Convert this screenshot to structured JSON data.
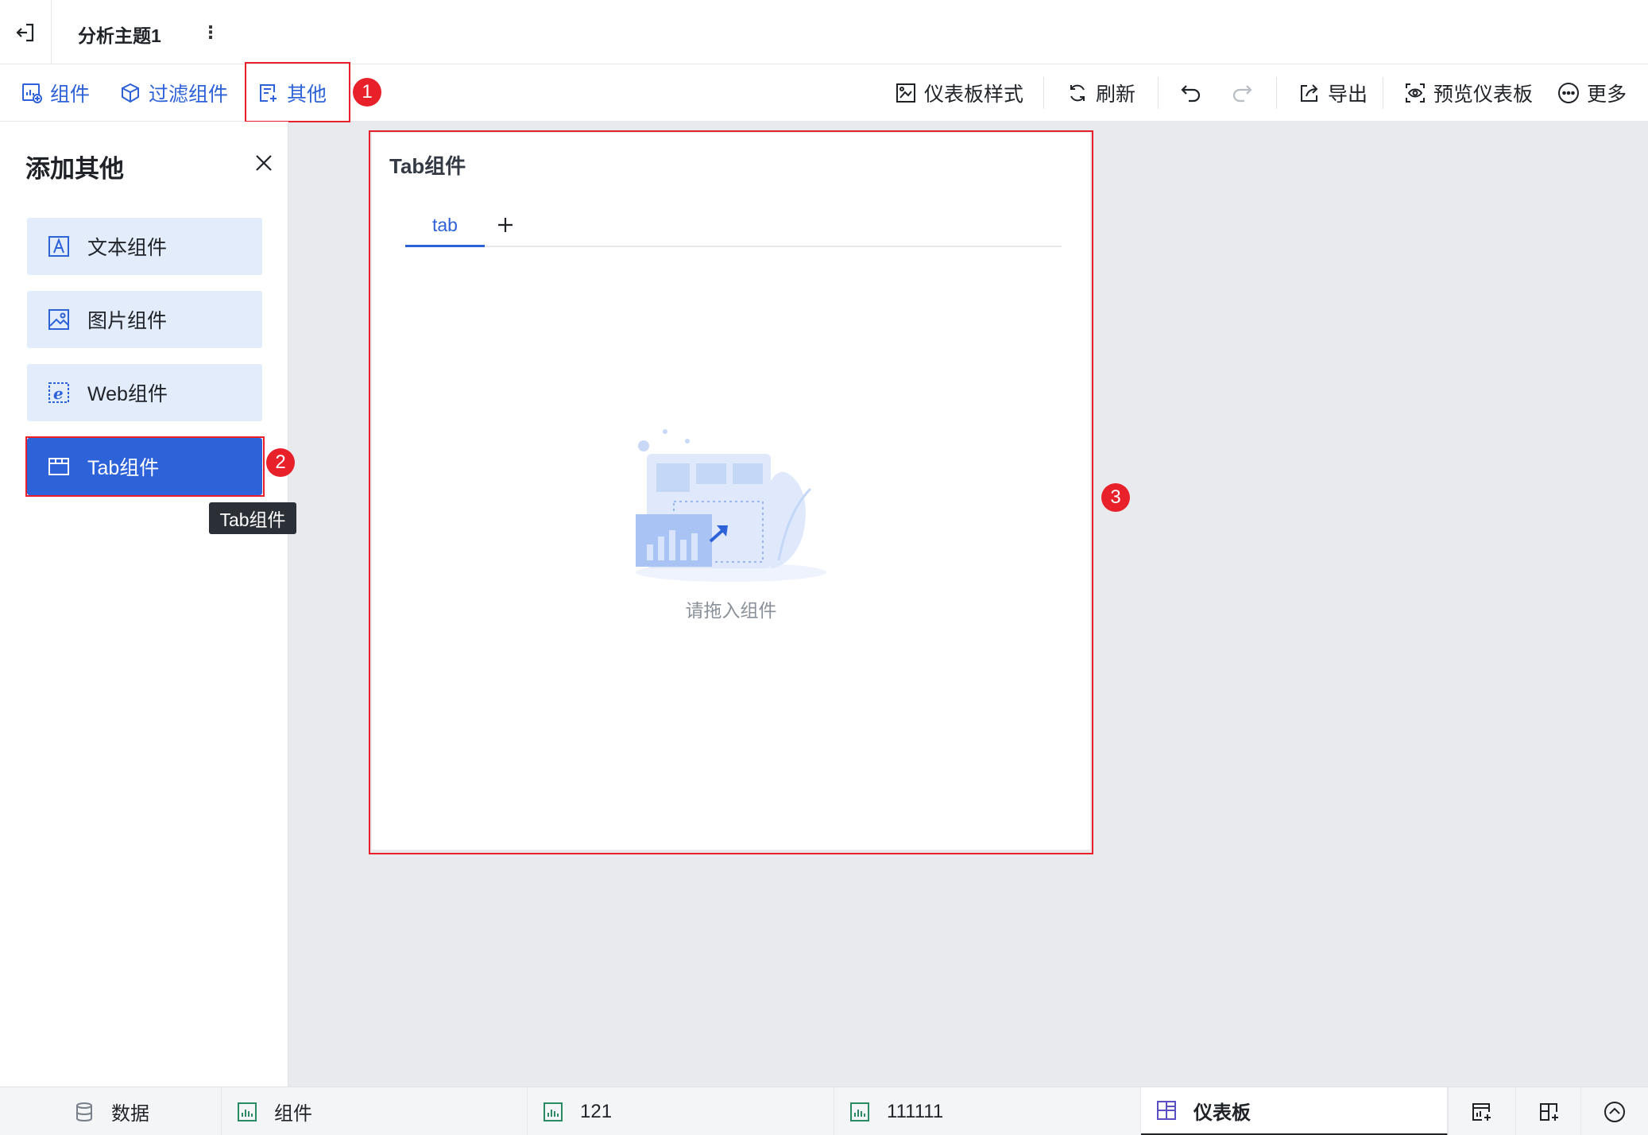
{
  "title_bar": {
    "title": "分析主题1",
    "more_glyph": "⋮"
  },
  "toolbar": {
    "left": [
      {
        "label": "组件",
        "icon": "chart-add-icon"
      },
      {
        "label": "过滤组件",
        "icon": "filter-cube-icon"
      },
      {
        "label": "其他",
        "icon": "document-add-icon"
      }
    ],
    "right": [
      {
        "label": "仪表板样式",
        "icon": "style-icon"
      },
      {
        "label": "刷新",
        "icon": "refresh-icon"
      },
      {
        "label": "导出",
        "icon": "export-icon"
      },
      {
        "label": "预览仪表板",
        "icon": "preview-icon"
      },
      {
        "label": "更多",
        "icon": "more-circle-icon"
      }
    ]
  },
  "annotations": {
    "badge1": "1",
    "badge2": "2",
    "badge3": "3",
    "highlight_color": "#e8202a"
  },
  "panel": {
    "title": "添加其他",
    "items": [
      {
        "label": "文本组件",
        "icon": "text-icon"
      },
      {
        "label": "图片组件",
        "icon": "image-icon"
      },
      {
        "label": "Web组件",
        "icon": "web-icon"
      },
      {
        "label": "Tab组件",
        "icon": "tab-icon",
        "active": true
      }
    ],
    "tooltip": "Tab组件"
  },
  "widget": {
    "title": "Tab组件",
    "tabs": [
      {
        "label": "tab",
        "active": true
      }
    ],
    "add_glyph": "+",
    "empty_text": "请拖入组件"
  },
  "bottom_tabs": [
    {
      "label": "数据",
      "icon": "database-icon"
    },
    {
      "label": "组件",
      "icon": "bar-chart-icon"
    },
    {
      "label": "121",
      "icon": "bar-chart-icon"
    },
    {
      "label": "111111",
      "icon": "bar-chart-icon"
    },
    {
      "label": "仪表板",
      "icon": "dashboard-icon",
      "active": true
    }
  ],
  "colors": {
    "accent": "#2e62d9",
    "panel_item_bg": "#e3ecfb",
    "canvas_bg": "#e8eaee"
  }
}
